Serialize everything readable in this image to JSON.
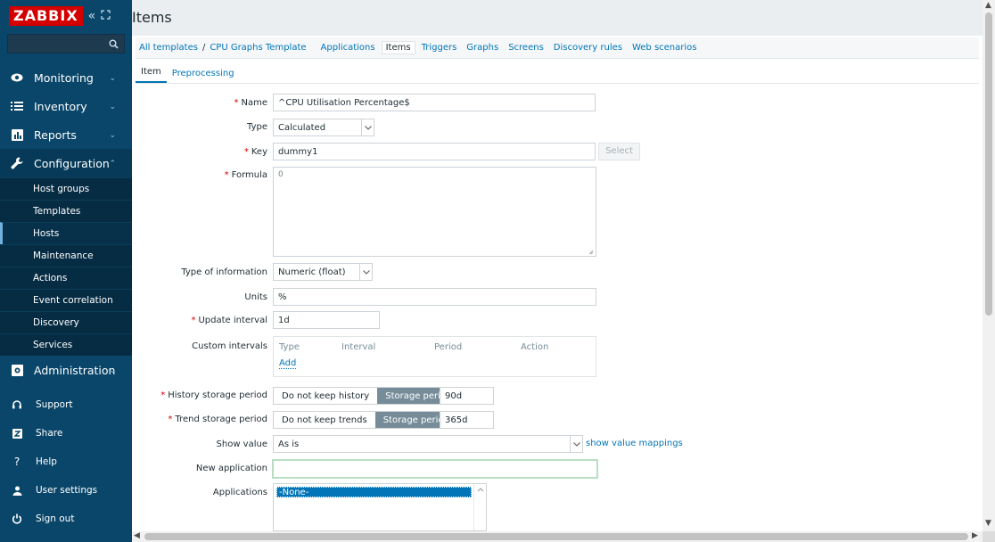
{
  "sidebar": {
    "logo": "ZABBIX",
    "collapse_glyph": "«",
    "kiosk_glyph": "⛶",
    "search_placeholder": "",
    "menu": [
      {
        "label": "Monitoring",
        "icon": "eye-icon"
      },
      {
        "label": "Inventory",
        "icon": "list-icon"
      },
      {
        "label": "Reports",
        "icon": "bar-chart-icon"
      },
      {
        "label": "Configuration",
        "icon": "wrench-icon"
      }
    ],
    "config_submenu": [
      "Host groups",
      "Templates",
      "Hosts",
      "Maintenance",
      "Actions",
      "Event correlation",
      "Discovery",
      "Services"
    ],
    "admin": {
      "label": "Administration",
      "icon": "gear-icon"
    },
    "bottom": [
      {
        "label": "Support",
        "icon": "headset-icon"
      },
      {
        "label": "Share",
        "icon": "share-icon"
      },
      {
        "label": "Help",
        "icon": "help-icon"
      },
      {
        "label": "User settings",
        "icon": "user-icon"
      },
      {
        "label": "Sign out",
        "icon": "power-icon"
      }
    ]
  },
  "header": {
    "title": "Items"
  },
  "breadcrumbs": {
    "all_templates": "All templates",
    "separator": "/",
    "template": "CPU Graphs Template",
    "tabs": [
      "Applications",
      "Items",
      "Triggers",
      "Graphs",
      "Screens",
      "Discovery rules",
      "Web scenarios"
    ]
  },
  "subtabs": {
    "item": "Item",
    "preprocessing": "Preprocessing"
  },
  "form": {
    "name_label": "Name",
    "name_value": "^CPU Utilisation Percentage$",
    "type_label": "Type",
    "type_value": "Calculated",
    "key_label": "Key",
    "key_value": "dummy1",
    "select_button": "Select",
    "formula_label": "Formula",
    "formula_value": "0",
    "type_info_label": "Type of information",
    "type_info_value": "Numeric (float)",
    "units_label": "Units",
    "units_value": "%",
    "update_label": "Update interval",
    "update_value": "1d",
    "custom_label": "Custom intervals",
    "custom_cols": [
      "Type",
      "Interval",
      "Period",
      "Action"
    ],
    "custom_add": "Add",
    "history_label": "History storage period",
    "history_opts": [
      "Do not keep history",
      "Storage period"
    ],
    "history_value": "90d",
    "trend_label": "Trend storage period",
    "trend_opts": [
      "Do not keep trends",
      "Storage period"
    ],
    "trend_value": "365d",
    "show_value_label": "Show value",
    "show_value_value": "As is",
    "show_value_link": "show value mappings",
    "new_app_label": "New application",
    "new_app_value": "",
    "apps_label": "Applications",
    "apps_options": [
      "-None-"
    ]
  },
  "colors": {
    "sidebar": "#0a466a",
    "logo": "#d40000",
    "link": "#0275b8",
    "required": "#d40000",
    "segment_on": "#768d99"
  }
}
